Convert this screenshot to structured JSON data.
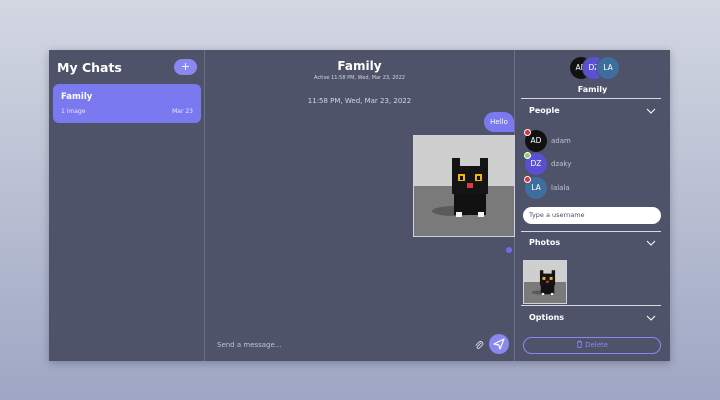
{
  "sidebar": {
    "title": "My Chats",
    "add_label": "+",
    "chats": [
      {
        "name": "Family",
        "preview": "1 image",
        "date": "Mar 23"
      }
    ]
  },
  "conversation": {
    "title": "Family",
    "active": "Active 11:58 PM, Wed, Mar 23, 2022",
    "timestamp": "11:58 PM, Wed, Mar 23, 2022",
    "messages": [
      {
        "type": "text",
        "text": "Hello"
      },
      {
        "type": "image",
        "alt": "voxel black cat"
      }
    ],
    "input_placeholder": "Send a message..."
  },
  "details": {
    "avatars": [
      "AD",
      "DZ",
      "LA"
    ],
    "group_name": "Family",
    "people_label": "People",
    "people": [
      {
        "initials": "AD",
        "name": "adam",
        "status_color": "#e0303a",
        "avatar_color": "#111111"
      },
      {
        "initials": "DZ",
        "name": "dzaky",
        "status_color": "#8cd16a",
        "avatar_color": "#5b4fd3"
      },
      {
        "initials": "LA",
        "name": "lalala",
        "status_color": "#e0303a",
        "avatar_color": "#3d6e9e"
      }
    ],
    "username_placeholder": "Type a username",
    "photos_label": "Photos",
    "options_label": "Options",
    "delete_label": "Delete"
  },
  "colors": {
    "accent": "#7b79f0",
    "panel": "#4e536a"
  }
}
